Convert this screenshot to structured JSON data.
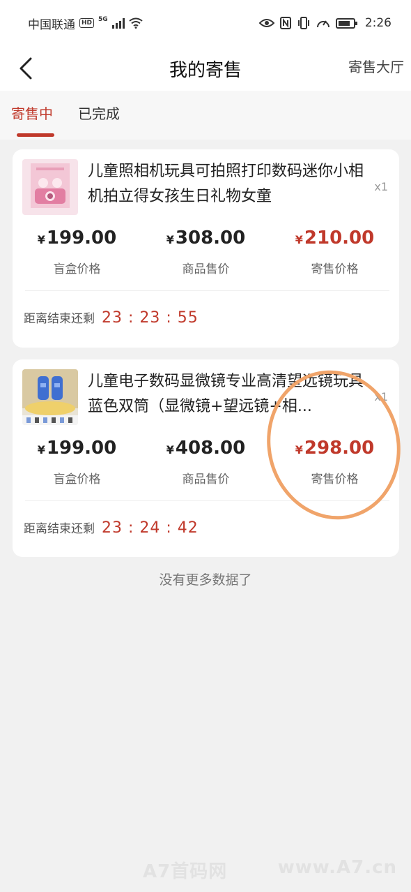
{
  "status_bar": {
    "carrier": "中国联通",
    "hd_badge": "HD",
    "network": "5G",
    "time": "2:26"
  },
  "nav": {
    "title": "我的寄售",
    "right_link": "寄售大厅"
  },
  "tabs": [
    {
      "label": "寄售中",
      "active": true
    },
    {
      "label": "已完成",
      "active": false
    }
  ],
  "items": [
    {
      "title": "儿童照相机玩具可拍照打印数码迷你小相机拍立得女孩生日礼物女童",
      "quantity": "x1",
      "prices": [
        {
          "currency": "¥",
          "value": "199.00",
          "label": "盲盒价格"
        },
        {
          "currency": "¥",
          "value": "308.00",
          "label": "商品售价"
        },
        {
          "currency": "¥",
          "value": "210.00",
          "label": "寄售价格"
        }
      ],
      "countdown_label": "距离结束还剩",
      "countdown": "23 : 23 : 55"
    },
    {
      "title": "儿童电子数码显微镜专业高清望远镜玩具 蓝色双筒（显微镜+望远镜+相...",
      "quantity": "x1",
      "prices": [
        {
          "currency": "¥",
          "value": "199.00",
          "label": "盲盒价格"
        },
        {
          "currency": "¥",
          "value": "408.00",
          "label": "商品售价"
        },
        {
          "currency": "¥",
          "value": "298.00",
          "label": "寄售价格"
        }
      ],
      "countdown_label": "距离结束还剩",
      "countdown": "23 : 24 : 42"
    }
  ],
  "footer_text": "没有更多数据了",
  "watermark": {
    "left": "A7首码网",
    "right": "www.A7.cn"
  },
  "colors": {
    "accent": "#c0392b",
    "background": "#f1f1f1",
    "annotation": "#f0a46a"
  }
}
